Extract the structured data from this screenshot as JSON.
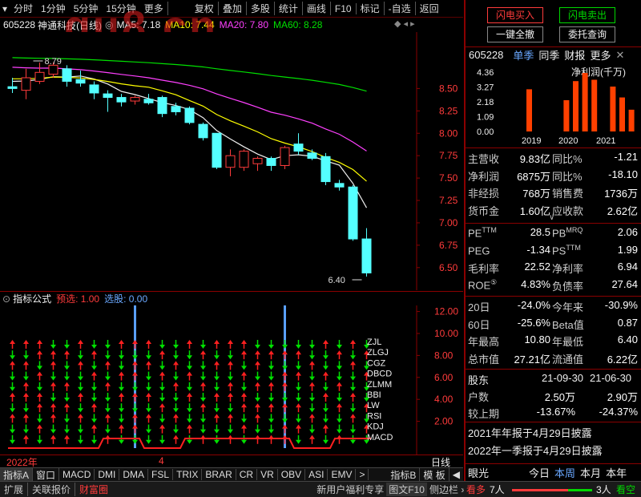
{
  "toolbar": {
    "periods": [
      "分时",
      "1分钟",
      "5分钟",
      "15分钟",
      "更多"
    ],
    "actions": [
      "复权",
      "叠加",
      "多股",
      "统计",
      "画线",
      "F10",
      "标记",
      "-自选",
      "返回"
    ]
  },
  "stock": {
    "code": "605228",
    "name": "神通科技",
    "period": "(日线)"
  },
  "ma": [
    {
      "label": "MA5: 7.18",
      "color": "#f0f0f0"
    },
    {
      "label": "MA10: 7.44",
      "color": "#ffff00"
    },
    {
      "label": "MA20: 7.80",
      "color": "#ff40ff"
    },
    {
      "label": "MA60: 8.28",
      "color": "#00e000"
    }
  ],
  "watermark": "gu8.cn",
  "price_axis": [
    "8.50",
    "8.25",
    "8.00",
    "7.75",
    "7.50",
    "7.25",
    "7.00",
    "6.75",
    "6.50"
  ],
  "high_label": "8.79",
  "low_label": "6.40",
  "candles": [
    {
      "o": 8.52,
      "c": 8.5,
      "h": 8.62,
      "l": 8.45
    },
    {
      "o": 8.48,
      "c": 8.62,
      "h": 8.72,
      "l": 8.38
    },
    {
      "o": 8.58,
      "c": 8.68,
      "h": 8.79,
      "l": 8.55
    },
    {
      "o": 8.66,
      "c": 8.76,
      "h": 8.79,
      "l": 8.62
    },
    {
      "o": 8.72,
      "c": 8.58,
      "h": 8.76,
      "l": 8.52
    },
    {
      "o": 8.6,
      "c": 8.56,
      "h": 8.7,
      "l": 8.52
    },
    {
      "o": 8.54,
      "c": 8.45,
      "h": 8.58,
      "l": 8.38
    },
    {
      "o": 8.44,
      "c": 8.4,
      "h": 8.48,
      "l": 8.24
    },
    {
      "o": 8.4,
      "c": 8.35,
      "h": 8.44,
      "l": 8.3
    },
    {
      "o": 8.36,
      "c": 8.4,
      "h": 8.42,
      "l": 8.32
    },
    {
      "o": 8.38,
      "c": 8.34,
      "h": 8.44,
      "l": 8.32
    },
    {
      "o": 8.4,
      "c": 8.22,
      "h": 8.42,
      "l": 8.18
    },
    {
      "o": 8.3,
      "c": 8.24,
      "h": 8.34,
      "l": 8.2
    },
    {
      "o": 8.28,
      "c": 8.12,
      "h": 8.3,
      "l": 8.1
    },
    {
      "o": 8.1,
      "c": 7.95,
      "h": 8.12,
      "l": 7.92
    },
    {
      "o": 8.0,
      "c": 7.62,
      "h": 8.0,
      "l": 7.6
    },
    {
      "o": 7.62,
      "c": 7.75,
      "h": 7.82,
      "l": 7.52
    },
    {
      "o": 7.62,
      "c": 7.8,
      "h": 7.82,
      "l": 7.58
    },
    {
      "o": 7.66,
      "c": 7.72,
      "h": 7.74,
      "l": 7.58
    },
    {
      "o": 7.72,
      "c": 7.64,
      "h": 7.74,
      "l": 7.58
    },
    {
      "o": 7.64,
      "c": 7.84,
      "h": 7.86,
      "l": 7.6
    },
    {
      "o": 7.88,
      "c": 7.8,
      "h": 8.0,
      "l": 7.76
    },
    {
      "o": 7.78,
      "c": 7.72,
      "h": 7.82,
      "l": 7.7
    },
    {
      "o": 7.74,
      "c": 7.46,
      "h": 7.78,
      "l": 7.42
    },
    {
      "o": 7.44,
      "c": 7.4,
      "h": 7.48,
      "l": 7.36
    },
    {
      "o": 7.4,
      "c": 6.82,
      "h": 7.42,
      "l": 6.8
    },
    {
      "o": 6.82,
      "c": 6.44,
      "h": 6.94,
      "l": 6.4
    }
  ],
  "indicator": {
    "title": "指标公式",
    "preselect": "预选: 1.00",
    "select": "选股: 0.00",
    "axis": [
      "12.00",
      "10.00",
      "8.00",
      "6.00",
      "4.00",
      "2.00"
    ],
    "names": [
      "ZJL",
      "ZLGJ",
      "CGZ",
      "DBCD",
      "ZLMM",
      "BBI",
      "LW",
      "RSI",
      "KDJ",
      "MACD"
    ]
  },
  "timeline": {
    "year": "2022年",
    "month": "4",
    "period": "日线"
  },
  "tabs": [
    "指标A",
    "窗口",
    "MACD",
    "DMI",
    "DMA",
    "FSL",
    "TRIX",
    "BRAR",
    "CR",
    "VR",
    "OBV",
    "ASI",
    "EMV",
    ">"
  ],
  "tabs_right": [
    "指标B",
    "模 板",
    "◀"
  ],
  "bottom": {
    "left": [
      "扩展",
      "关联报价",
      "财富圈"
    ],
    "right": [
      "新用户福利专享",
      "图文F10",
      "侧边栏"
    ]
  },
  "side": {
    "buttons": [
      "闪电买入",
      "闪电卖出",
      "一键全撤",
      "委托查询"
    ],
    "code": "605228",
    "views": [
      "单季",
      "同季",
      "财报",
      "更多"
    ],
    "profit_title": "净利润(千万)",
    "bar_axis": [
      "4.36",
      "3.27",
      "2.18",
      "1.09",
      "0.00"
    ],
    "years": [
      "2019",
      "2020",
      "2021"
    ],
    "bars": [
      3.1,
      0,
      0,
      0,
      2.3,
      3.7,
      4.3,
      3.8,
      0,
      3.3,
      2.5,
      1.6
    ],
    "fin": [
      [
        "主营收",
        "9.83亿",
        "同比%",
        "-1.21"
      ],
      [
        "净利润",
        "6875万",
        "同比%",
        "-18.10"
      ],
      [
        "非经损",
        "768万",
        "销售费",
        "1736万"
      ],
      [
        "货币金",
        "1.60亿",
        "应收款",
        "2.62亿"
      ]
    ],
    "ratios": [
      [
        "PE",
        "TTM",
        "28.5",
        "PB",
        "MRQ",
        "2.06"
      ],
      [
        "PEG",
        "",
        "-1.34",
        "PS",
        "TTM",
        "1.99"
      ],
      [
        "毛利率",
        "",
        "22.52",
        "净利率",
        "",
        "6.94"
      ],
      [
        "ROE",
        "⑤",
        "4.83%",
        "负债率",
        "",
        "27.64"
      ]
    ],
    "perf": [
      [
        "20日",
        "-24.0%",
        "今年来",
        "-30.9%"
      ],
      [
        "60日",
        "-25.6%",
        "Beta值",
        "0.87"
      ],
      [
        "年最高",
        "10.80",
        "年最低",
        "6.40"
      ],
      [
        "总市值",
        "27.21亿",
        "流通值",
        "6.22亿"
      ]
    ],
    "holders_head": [
      "股东",
      "21-09-30",
      "21-06-30"
    ],
    "holders": [
      [
        "户数",
        "2.50万",
        "2.90万"
      ],
      [
        "较上期",
        "-13.67%",
        "-24.37%"
      ]
    ],
    "notes": [
      "2021年年报于4月29日披露",
      "2022年一季报于4月29日披露"
    ],
    "eye": [
      "眼光",
      "今日",
      "本周",
      "本月",
      "本年"
    ],
    "counts": [
      "看多",
      "7人",
      "3人",
      "看空"
    ]
  },
  "colors": {
    "up": "#ff3b3b",
    "down": "#54ffff",
    "border": "#8a0000",
    "accent": "#5aa0ff"
  }
}
